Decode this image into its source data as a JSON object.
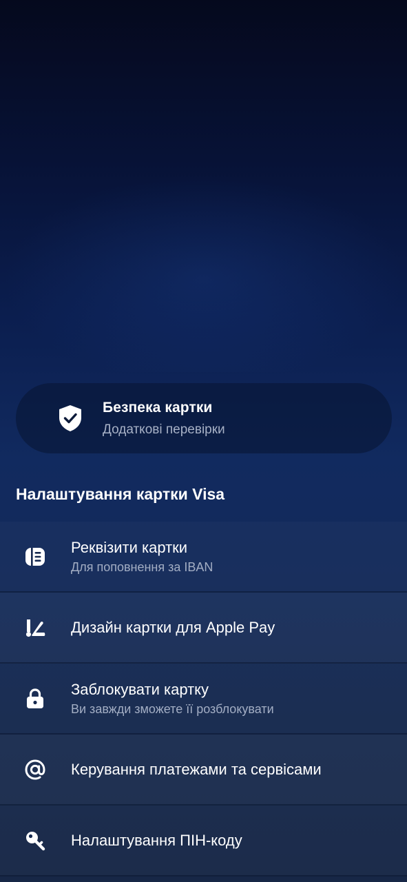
{
  "security": {
    "title": "Безпека картки",
    "subtitle": "Додаткові перевірки",
    "icon": "shield-check-icon"
  },
  "settings": {
    "section_title": "Налаштування картки Visa",
    "items": [
      {
        "label": "Реквізити картки",
        "sub": "Для поповнення за IBAN",
        "icon": "card-details-icon"
      },
      {
        "label": "Дизайн картки для Apple Pay",
        "sub": "",
        "icon": "brush-design-icon"
      },
      {
        "label": "Заблокувати картку",
        "sub": "Ви завжди зможете її розблокувати",
        "icon": "lock-icon"
      },
      {
        "label": "Керування платежами та сервісами",
        "sub": "",
        "icon": "at-sign-icon"
      },
      {
        "label": "Налаштування ПІН-коду",
        "sub": "",
        "icon": "key-icon"
      }
    ]
  }
}
